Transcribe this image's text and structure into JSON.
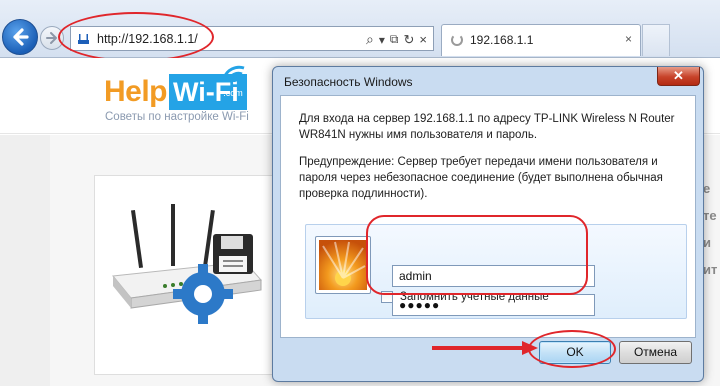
{
  "browser": {
    "address_url": "http://192.168.1.1/",
    "tab_title": "192.168.1.1",
    "tab_close": "×",
    "search_glyph": "⌕",
    "dropdown_glyph": "▾",
    "compat_glyph": "⧉",
    "refresh_glyph": "↻",
    "stop_glyph": "×"
  },
  "site": {
    "logo_help": "Help",
    "logo_wifi": "Wi-Fi",
    "logo_com": ".com",
    "tagline": "Советы по настройке Wi-Fi",
    "side_text": [
      "е",
      "те",
      "и",
      "ит"
    ]
  },
  "dialog": {
    "title": "Безопасность Windows",
    "close_label": "✕",
    "message": "Для входа на сервер 192.168.1.1 по адресу TP-LINK Wireless N Router WR841N нужны имя пользователя и пароль.",
    "warning": "Предупреждение: Сервер требует передачи имени пользователя и пароля через небезопасное соединение (будет выполнена обычная проверка подлинности).",
    "username": "admin",
    "password_mask": "●●●●●",
    "remember_label": "Запомнить учетные данные",
    "ok_label": "OK",
    "cancel_label": "Отмена"
  },
  "colors": {
    "annotation_red": "#e0262b",
    "logo_orange": "#f29b24",
    "logo_blue": "#24a3e6",
    "dialog_frame": "#c9dcf1"
  },
  "icons": [
    "back-arrow-icon",
    "forward-arrow-icon",
    "router-favicon-icon",
    "search-icon",
    "refresh-icon",
    "stop-icon",
    "loading-spinner-icon",
    "wifi-signal-icon",
    "router-illustration",
    "settings-gear-icon",
    "floppy-disk-icon",
    "user-picture-flower-icon",
    "red-arrow-annotation"
  ]
}
